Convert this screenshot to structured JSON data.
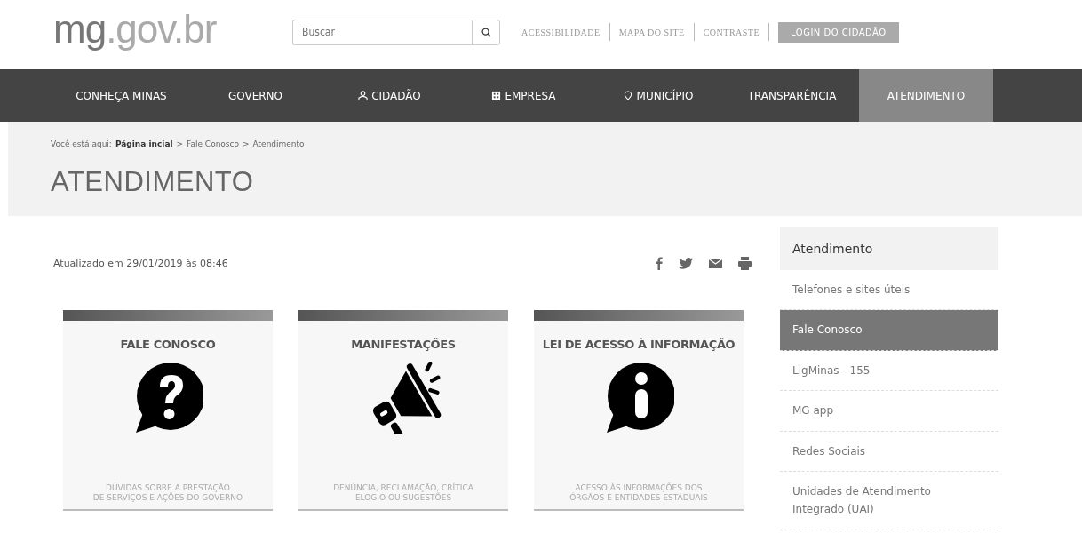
{
  "header": {
    "logo": {
      "part_1": "mg",
      "part_2": ".gov.br"
    },
    "search": {
      "placeholder": "Buscar"
    },
    "links": [
      "ACESSIBILIDADE",
      "MAPA DO SITE",
      "CONTRASTE"
    ],
    "login_button": "LOGIN DO CIDADÃO"
  },
  "nav": [
    {
      "label": "CONHEÇA MINAS",
      "kind": "text",
      "selected": false
    },
    {
      "label": "GOVERNO",
      "kind": "text",
      "selected": false
    },
    {
      "label": "CIDADÃO",
      "kind": "person",
      "selected": false
    },
    {
      "label": "EMPRESA",
      "kind": "building",
      "selected": false
    },
    {
      "label": "MUNICÍPIO",
      "kind": "pin",
      "selected": false
    },
    {
      "label": "TRANSPARÊNCIA",
      "kind": "text",
      "selected": false
    },
    {
      "label": "ATENDIMENTO",
      "kind": "text",
      "selected": true
    }
  ],
  "breadcrumb": {
    "prefix": "Você está aqui:",
    "items": [
      "Página incial",
      "Fale Conosco",
      "Atendimento"
    ],
    "separator": ">"
  },
  "page_title": "ATENDIMENTO",
  "updated": "Atualizado em 29/01/2019 às 08:46",
  "share_icons": [
    {
      "kind": "facebook"
    },
    {
      "kind": "twitter"
    },
    {
      "kind": "email"
    },
    {
      "kind": "print"
    }
  ],
  "cards": [
    {
      "title": "FALE CONOSCO",
      "kind": "question",
      "description": "DÚVIDAS SOBRE A PRESTAÇÃO\nDE SERVIÇOS E AÇÕES DO GOVERNO"
    },
    {
      "title": "MANIFESTAÇÕES",
      "kind": "megaphone",
      "description": "DENÚNCIA, RECLAMAÇÃO, CRÍTICA\nELOGIO OU SUGESTÕES"
    },
    {
      "title": "LEI DE ACESSO À INFORMAÇÃO",
      "kind": "info",
      "description": "ACESSO ÀS INFORMAÇÕES DOS\nÓRGÃOS E ENTIDADES ESTADUAIS"
    }
  ],
  "sidebar": {
    "title": "Atendimento",
    "items": [
      {
        "label": "Telefones e sites úteis",
        "selected": false
      },
      {
        "label": "Fale Conosco",
        "selected": true
      },
      {
        "label": "LigMinas - 155",
        "selected": false
      },
      {
        "label": "MG app",
        "selected": false
      },
      {
        "label": "Redes Sociais",
        "selected": false
      },
      {
        "label": "Unidades de Atendimento\nIntegrado (UAI)",
        "selected": false
      }
    ]
  }
}
